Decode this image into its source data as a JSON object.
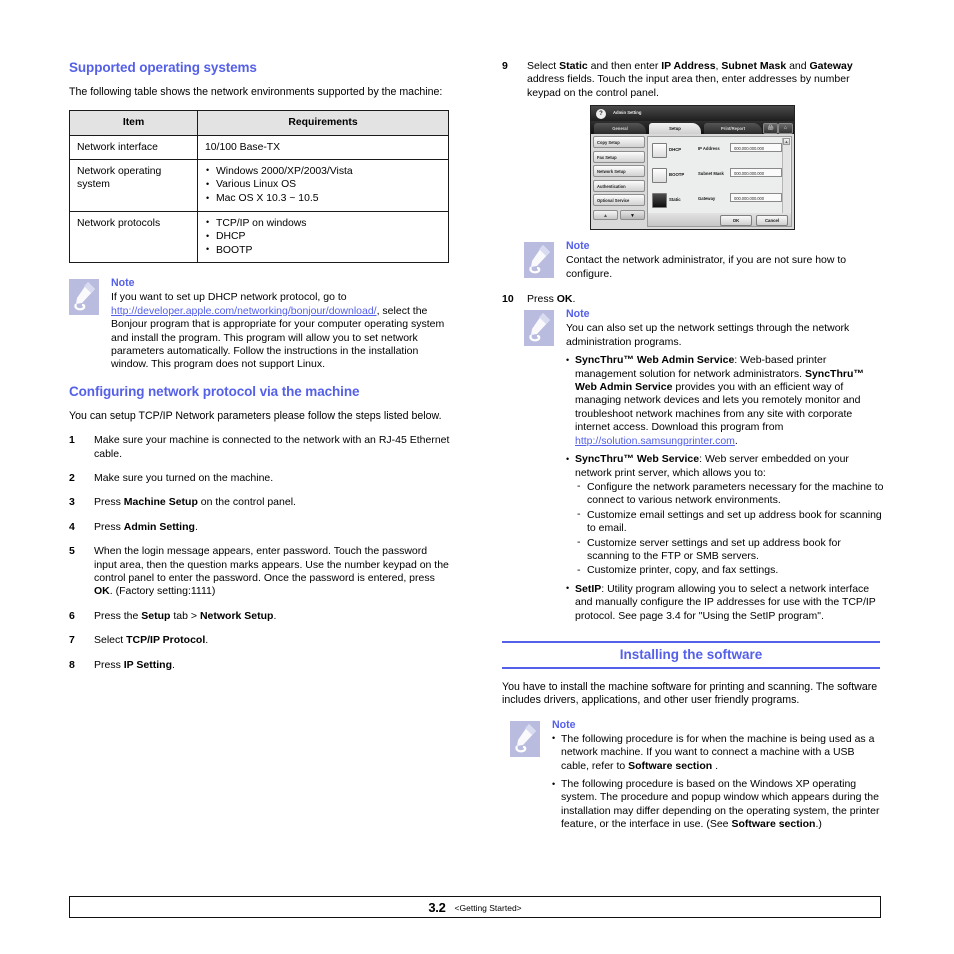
{
  "document": {
    "footer": {
      "page_number": "3.2",
      "chapter_title": "<Getting Started>"
    }
  },
  "left_column": {
    "heading_supported_os": "Supported operating systems",
    "intro_paragraph": "The following table shows the network environments supported by the machine:",
    "table": {
      "headers": [
        "Item",
        "Requirements"
      ],
      "rows": [
        {
          "item": "Network interface",
          "requirements_text": "10/100 Base-TX",
          "requirements_list": []
        },
        {
          "item": "Network operating system",
          "requirements_text": "",
          "requirements_list": [
            "Windows 2000/XP/2003/Vista",
            "Various Linux OS",
            "Mac OS X 10.3 ~ 10.5"
          ]
        },
        {
          "item": "Network protocols",
          "requirements_text": "",
          "requirements_list": [
            "TCP/IP on windows",
            "DHCP",
            "BOOTP"
          ]
        }
      ]
    },
    "note_dhcp": {
      "title": "Note",
      "text_part1": "If you want to set up DHCP network protocol, go to ",
      "link": "http://developer.apple.com/networking/bonjour/download/",
      "text_part2": ", select the Bonjour program that is appropriate for your computer operating system and install the program. This program will allow you to set network parameters automatically. Follow the instructions in the installation window. This program does not support Linux."
    },
    "heading_configuring": "Configuring network protocol via the machine",
    "configuring_intro": "You can setup TCP/IP Network parameters please follow the steps listed below.",
    "steps": [
      {
        "num": "1",
        "text": "Make sure your machine is connected to the network with an RJ-45 Ethernet cable."
      },
      {
        "num": "2",
        "text": "Make sure you turned on the machine."
      },
      {
        "num": "3",
        "text": "Press <b>Machine Setup</b> on the control panel."
      },
      {
        "num": "4",
        "text": "Press <b>Admin Setting</b>."
      },
      {
        "num": "5",
        "text": "When the login message appears, enter password. Touch the password input area, then the question marks appears. Use the number keypad on the control panel to enter the password. Once the password is entered, press <b>OK</b>. (Factory setting:1111)"
      },
      {
        "num": "6",
        "text": "Press the <b>Setup</b> tab > <b>Network Setup</b>."
      },
      {
        "num": "7",
        "text": "Select <b>TCP/IP Protocol</b>."
      },
      {
        "num": "8",
        "text": "Press <b>IP Setting</b>."
      }
    ]
  },
  "right_column": {
    "step9": {
      "num": "9",
      "text": "Select <b>Static</b> and then enter <b>IP Address</b>, <b>Subnet Mask</b> and <b>Gateway</b> address fields. Touch the input area then, enter addresses by number keypad on the control panel."
    },
    "panel_screenshot": {
      "window_title": "Admin Setting",
      "logo_glyph": "?",
      "tabs": [
        {
          "label": "General",
          "active": false
        },
        {
          "label": "Setup",
          "active": true
        },
        {
          "label": "Print/Report",
          "active": false
        }
      ],
      "tab_icons": [
        "print-icon",
        "home-icon"
      ],
      "sidebar_items": [
        "Copy Setup",
        "Fax Setup",
        "Network Setup",
        "Authentication",
        "Optional Service"
      ],
      "sidebar_arrows": [
        "▲",
        "▼"
      ],
      "radio_options": [
        {
          "label": "DHCP",
          "selected": false
        },
        {
          "label": "BOOTP",
          "selected": false
        },
        {
          "label": "Static",
          "selected": true
        }
      ],
      "fields": [
        {
          "label": "IP Address",
          "value": "000.000.000.000"
        },
        {
          "label": "Subnet Mask",
          "value": "000.000.000.000"
        },
        {
          "label": "Gateway",
          "value": "000.000.000.000"
        }
      ],
      "buttons": [
        "OK",
        "Cancel"
      ],
      "scroll_glyphs": [
        "▲",
        "▼"
      ]
    },
    "note_contact": {
      "title": "Note",
      "text": "Contact the network administrator, if you are not sure how to configure."
    },
    "step10": {
      "num": "10",
      "text": "Press <b>OK</b>."
    },
    "note_network_programs": {
      "title": "Note",
      "intro": "You can also set up the network settings through the network administration programs.",
      "bullets": [
        {
          "html": "<b>SyncThru™ Web Admin Service</b>: Web-based printer management solution for network administrators. <b>SyncThru™ Web Admin Service</b> provides you with an efficient way of managing network devices and lets you remotely monitor and troubleshoot network machines from any site with corporate internet access. Download this program from <a class=\"doclink\" href=\"#\" data-name=\"samsung-solution-link\" data-interactable=\"true\">http://solution.samsungprinter.com</a>.",
          "sub": []
        },
        {
          "html": "<b>SyncThru™ Web Service</b>: Web server embedded on your network print server, which allows you to:",
          "sub": [
            "Configure the network parameters necessary for the machine to connect to various network environments.",
            "Customize email settings and set up address book for scanning to email.",
            "Customize server settings and set up address book for scanning to the FTP or SMB servers.",
            "Customize printer, copy, and fax settings."
          ]
        },
        {
          "html": "<b>SetIP</b>: Utility program allowing you to select a network interface and manually configure the IP addresses for use with the TCP/IP protocol. See  page 3.4 for \"Using the SetIP program\".",
          "sub": []
        }
      ]
    },
    "heading_installing": "Installing the software",
    "installing_intro": "You have to install the machine software for printing and scanning. The software includes drivers, applications, and other user friendly programs.",
    "note_installing": {
      "title": "Note",
      "bullets": [
        "The following procedure is for when the machine is being used as a network machine. If you want to connect a machine with a USB cable, refer to <b>Software section</b> .",
        "The following procedure is based on the Windows XP operating system. The procedure and popup window which appears during the installation may differ depending on the operating system, the printer feature, or the interface in use. (See <b>Software section</b>.)"
      ]
    }
  },
  "colors": {
    "heading_blue": "#5560e8",
    "note_icon_bg": "#b9bbdf",
    "table_header_bg": "#e3e3e3",
    "text": "#000000"
  }
}
